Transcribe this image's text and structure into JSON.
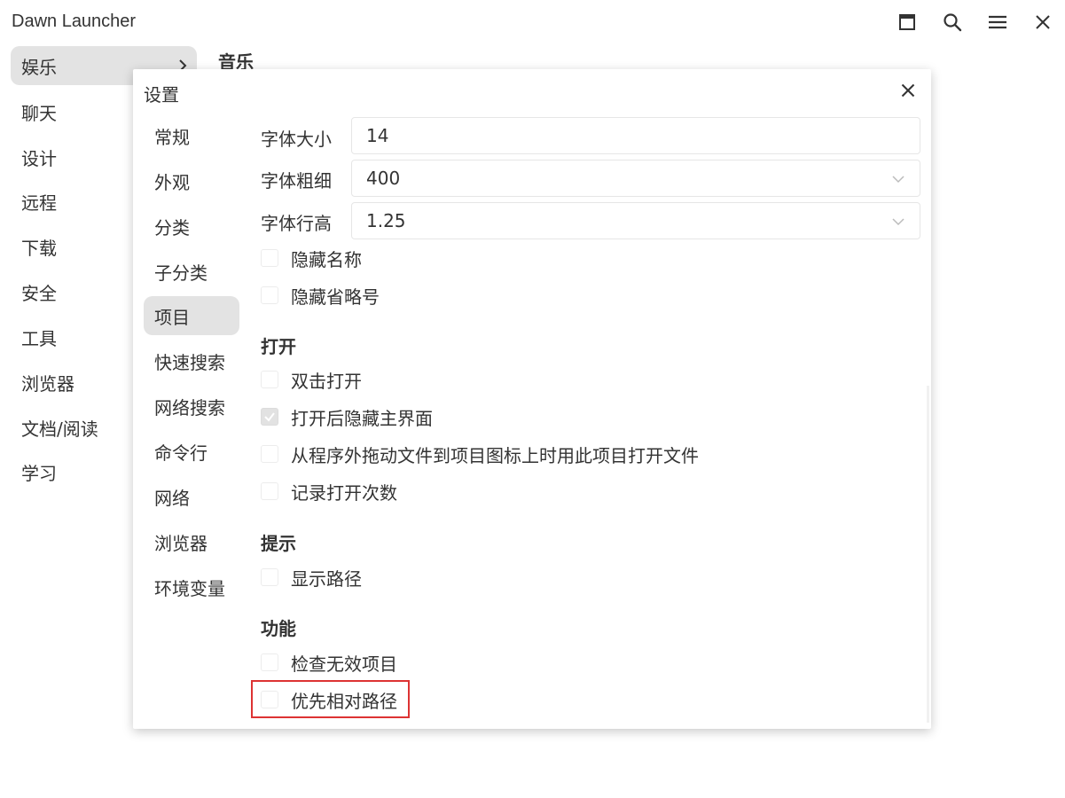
{
  "app": {
    "title": "Dawn Launcher",
    "window_buttons": [
      {
        "name": "maximize-icon"
      },
      {
        "name": "search-icon"
      },
      {
        "name": "menu-icon"
      },
      {
        "name": "close-icon"
      }
    ]
  },
  "sidebar": {
    "items": [
      {
        "label": "娱乐",
        "active": true
      },
      {
        "label": "聊天"
      },
      {
        "label": "设计"
      },
      {
        "label": "远程"
      },
      {
        "label": "下载"
      },
      {
        "label": "安全"
      },
      {
        "label": "工具"
      },
      {
        "label": "浏览器"
      },
      {
        "label": "文档/阅读"
      },
      {
        "label": "学习"
      }
    ]
  },
  "main": {
    "section_heading": "音乐"
  },
  "settings": {
    "title": "设置",
    "nav": [
      {
        "label": "常规"
      },
      {
        "label": "外观"
      },
      {
        "label": "分类"
      },
      {
        "label": "子分类"
      },
      {
        "label": "项目",
        "active": true
      },
      {
        "label": "快速搜索"
      },
      {
        "label": "网络搜索"
      },
      {
        "label": "命令行"
      },
      {
        "label": "网络"
      },
      {
        "label": "浏览器"
      },
      {
        "label": "环境变量"
      }
    ],
    "fields": {
      "font_size": {
        "label": "字体大小",
        "value": "14"
      },
      "font_weight": {
        "label": "字体粗细",
        "value": "400"
      },
      "line_height": {
        "label": "字体行高",
        "value": "1.25"
      }
    },
    "display_options": [
      {
        "label": "隐藏名称",
        "checked": false
      },
      {
        "label": "隐藏省略号",
        "checked": false
      }
    ],
    "groups": {
      "open": {
        "heading": "打开",
        "options": [
          {
            "label": "双击打开",
            "checked": false
          },
          {
            "label": "打开后隐藏主界面",
            "checked": true
          },
          {
            "label": "从程序外拖动文件到项目图标上时用此项目打开文件",
            "checked": false
          },
          {
            "label": "记录打开次数",
            "checked": false
          }
        ]
      },
      "tips": {
        "heading": "提示",
        "options": [
          {
            "label": "显示路径",
            "checked": false
          }
        ]
      },
      "function": {
        "heading": "功能",
        "options": [
          {
            "label": "检查无效项目",
            "checked": false
          },
          {
            "label": "优先相对路径",
            "checked": false
          }
        ]
      }
    }
  },
  "colors": {
    "active_bg": "#e3e3e3",
    "highlight": "#dd3333",
    "text": "#333333"
  }
}
